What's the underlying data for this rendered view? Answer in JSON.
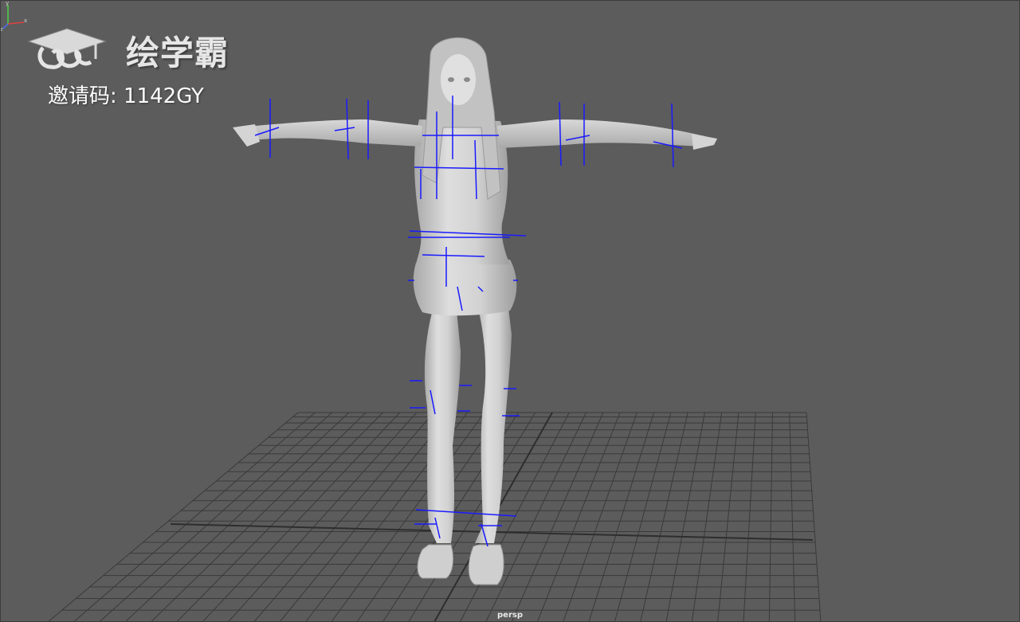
{
  "watermark": {
    "brand": "绘学霸",
    "invite_text": "邀请码: 1142GY",
    "logo_icon": "graduation-cap-cloud-icon"
  },
  "viewport": {
    "camera_label": "persp",
    "background_color": "#5c5c5c",
    "grid_color": "#3a3a3a",
    "model_color": "#cfcfcf",
    "joint_color": "#1a1aff"
  },
  "axis_gizmo": {
    "x_label": "x",
    "y_label": "y",
    "z_label": "z"
  }
}
